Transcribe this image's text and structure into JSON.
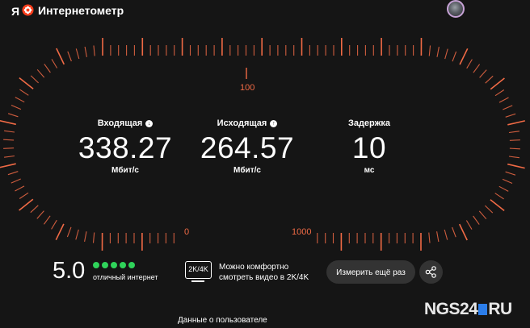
{
  "header": {
    "logo_letter": "Я",
    "title": "Интернетометр"
  },
  "metrics": {
    "download": {
      "label": "Входящая",
      "value": "338.27",
      "unit": "Мбит/с"
    },
    "upload": {
      "label": "Исходящая",
      "value": "264.57",
      "unit": "Мбит/с"
    },
    "latency": {
      "label": "Задержка",
      "value": "10",
      "unit": "мс"
    }
  },
  "scale": {
    "mark_top": "100",
    "mark_left": "0",
    "mark_right": "1000"
  },
  "summary": {
    "score": "5.0",
    "stars_filled": 5,
    "stars_total": 5,
    "rating_text": "отличный интернет",
    "quality_badge": "2K/4K",
    "quality_line1": "Можно комфортно",
    "quality_line2": "смотреть видео в 2K/4K"
  },
  "actions": {
    "retest_label": "Измерить ещё раз",
    "share_icon": "share-icon"
  },
  "footer": {
    "user_data_link": "Данные о пользователе"
  },
  "watermark": {
    "left": "NGS24",
    "right": "RU"
  },
  "colors": {
    "background": "#151515",
    "accent": "#f06a45",
    "rating_green": "#2fd35a",
    "button_bg": "#333333"
  }
}
